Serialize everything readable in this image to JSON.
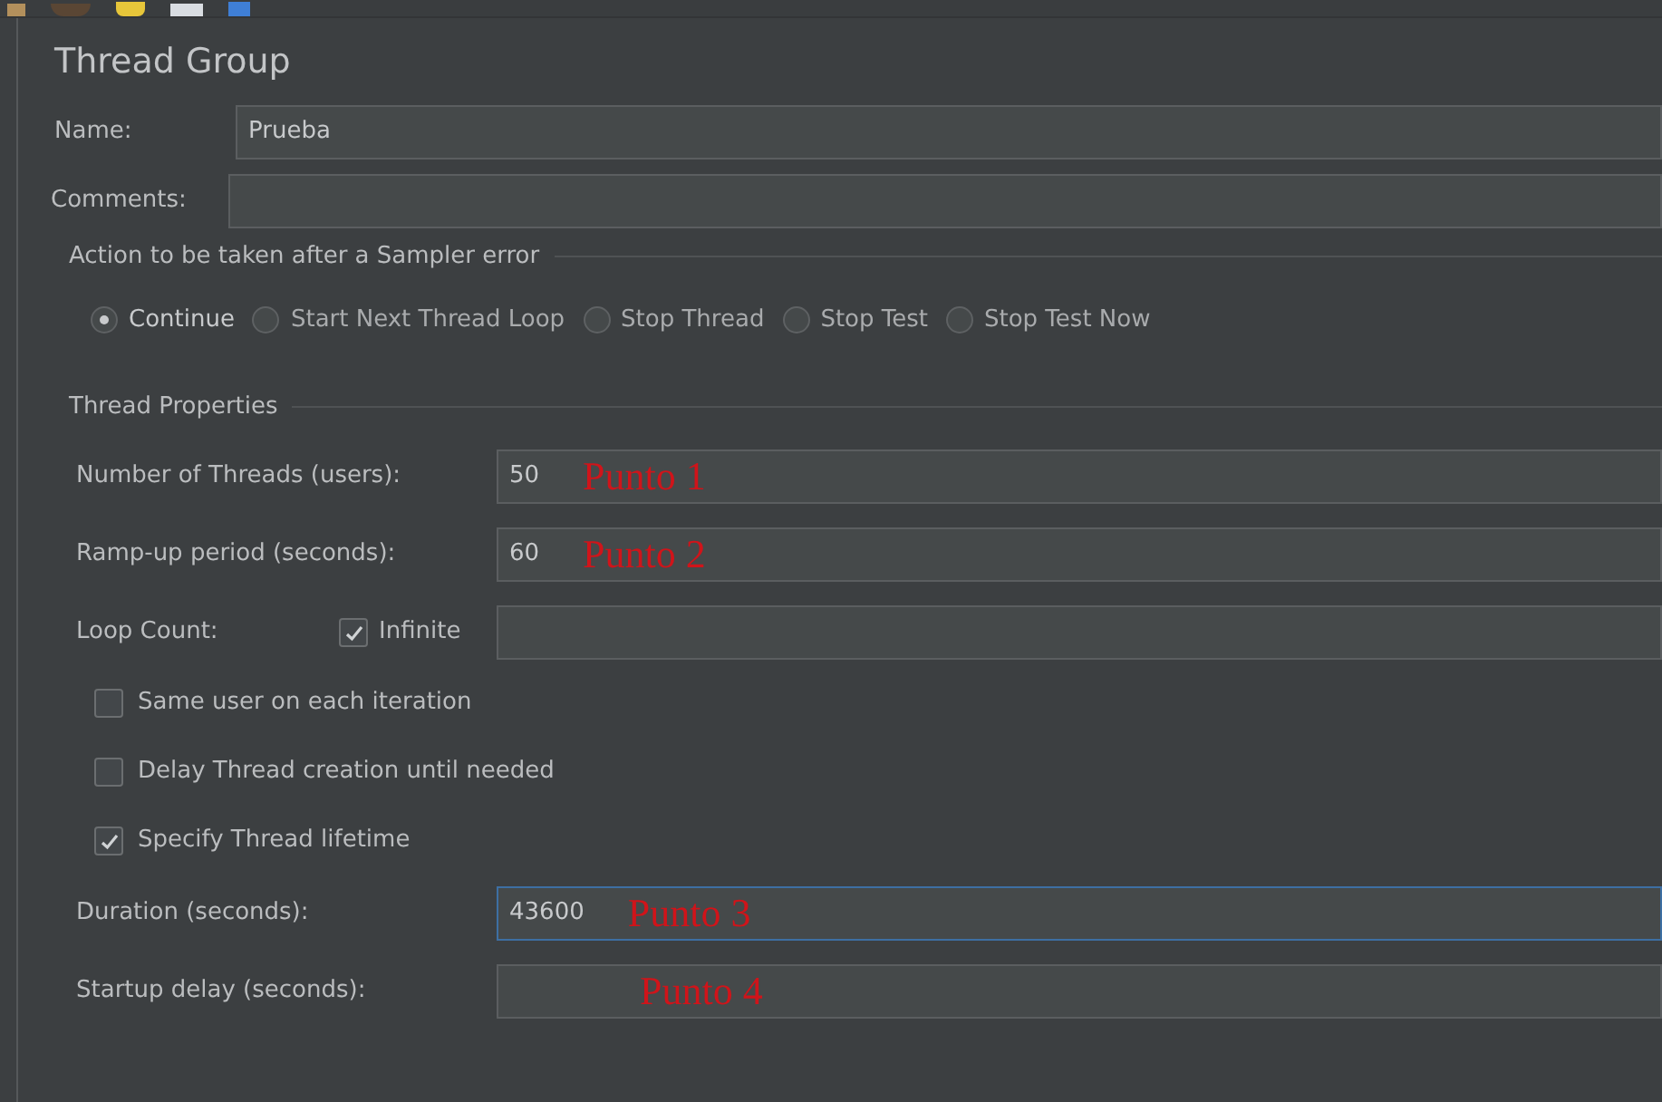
{
  "panel": {
    "title": "Thread Group"
  },
  "name": {
    "label": "Name:",
    "value": "Prueba"
  },
  "comments": {
    "label": "Comments:"
  },
  "sampler_error": {
    "legend": "Action to be taken after a Sampler error",
    "options": [
      {
        "label": "Continue",
        "selected": true
      },
      {
        "label": "Start Next Thread Loop",
        "selected": false
      },
      {
        "label": "Stop Thread",
        "selected": false
      },
      {
        "label": "Stop Test",
        "selected": false
      },
      {
        "label": "Stop Test Now",
        "selected": false
      }
    ]
  },
  "thread_properties": {
    "legend": "Thread Properties",
    "rows": [
      {
        "kind": "field",
        "label": "Number of Threads (users):",
        "value": "50",
        "annotation": "Punto 1",
        "focused": false
      },
      {
        "kind": "field",
        "label": "Ramp-up period (seconds):",
        "value": "60",
        "annotation": "Punto 2",
        "focused": false
      },
      {
        "kind": "loop",
        "label": "Loop Count:",
        "checkbox": "Infinite",
        "checked": true
      },
      {
        "kind": "check",
        "label": "Same user on each iteration",
        "checked": false
      },
      {
        "kind": "check",
        "label": "Delay Thread creation until needed",
        "checked": false
      },
      {
        "kind": "check",
        "label": "Specify Thread lifetime",
        "checked": true
      },
      {
        "kind": "wide",
        "label": "Duration (seconds):",
        "value": "43600",
        "annotation": "Punto 3",
        "focused": true
      },
      {
        "kind": "wide",
        "label": "Startup delay (seconds):",
        "annotation": "Punto 4",
        "focused": false
      }
    ]
  }
}
